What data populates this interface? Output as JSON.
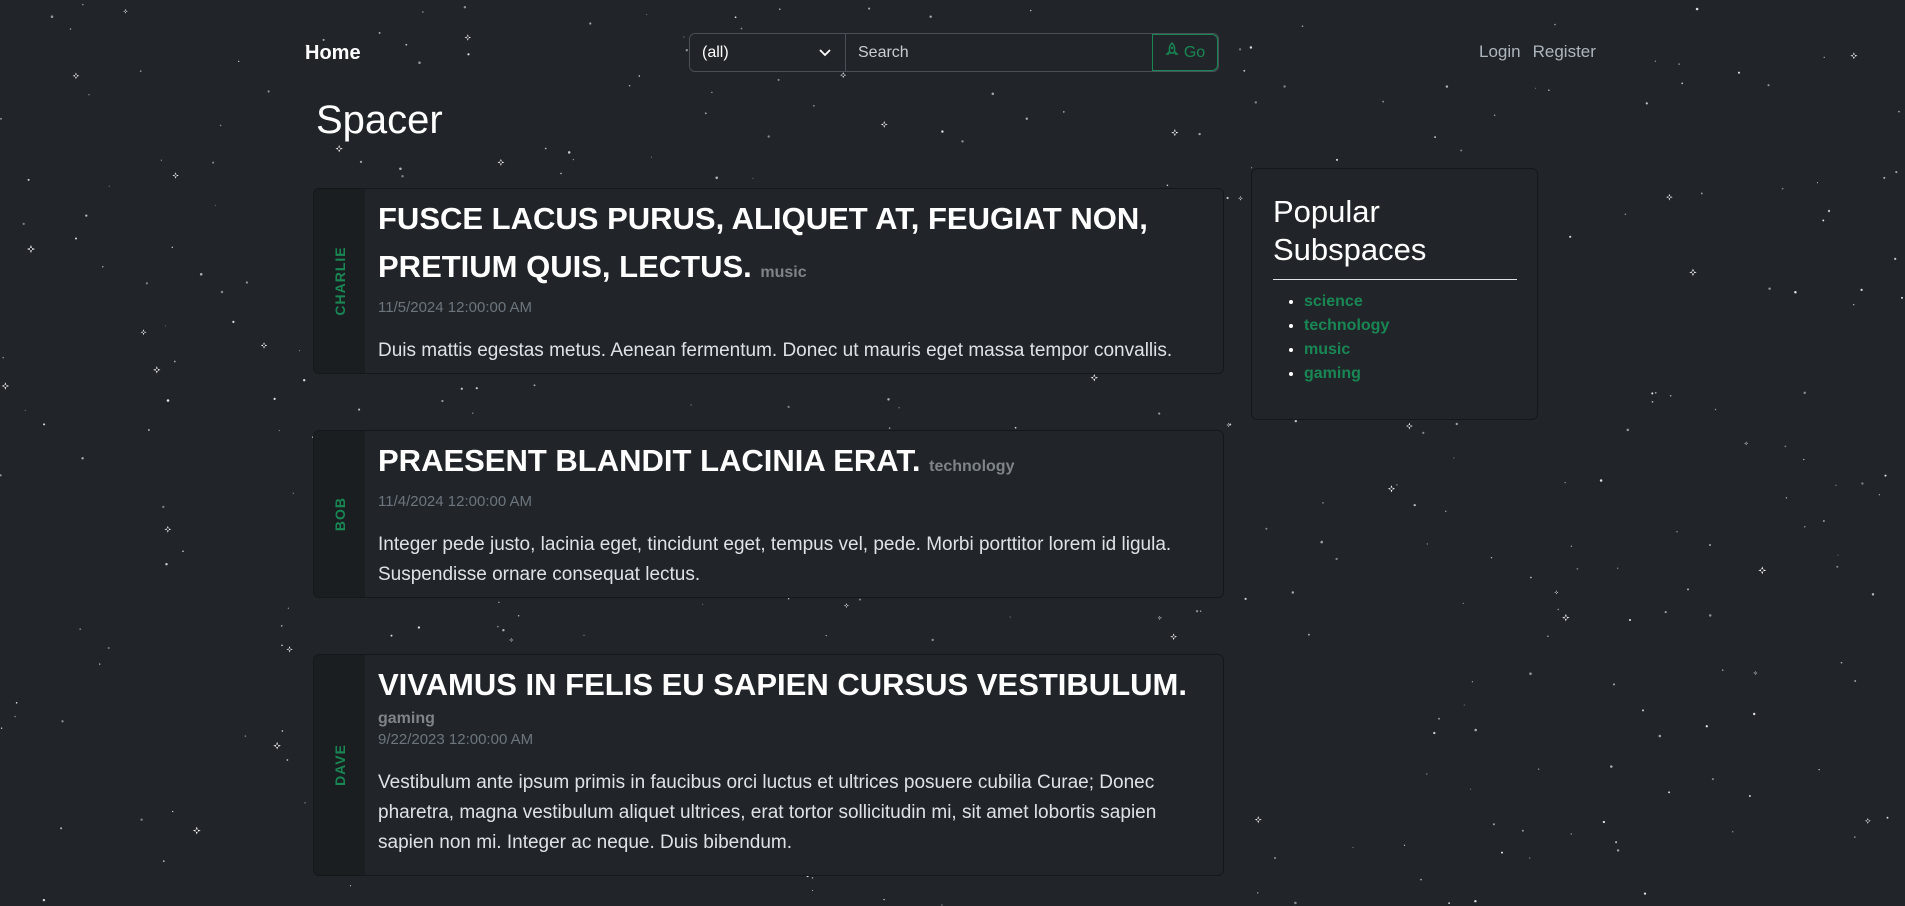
{
  "nav": {
    "brand": "Home",
    "search": {
      "selected": "(all)",
      "placeholder": "Search",
      "go_label": "Go"
    },
    "login": "Login",
    "register": "Register"
  },
  "page_title": "Spacer",
  "posts": [
    {
      "author": "CHARLIE",
      "title": "FUSCE LACUS PURUS, ALIQUET AT, FEUGIAT NON, PRETIUM QUIS, LECTUS.",
      "subspace": "music",
      "date": "11/5/2024 12:00:00 AM",
      "text": "Duis mattis egestas metus. Aenean fermentum. Donec ut mauris eget massa tempor convallis."
    },
    {
      "author": "BOB",
      "title": "PRAESENT BLANDIT LACINIA ERAT.",
      "subspace": "technology",
      "date": "11/4/2024 12:00:00 AM",
      "text": "Integer pede justo, lacinia eget, tincidunt eget, tempus vel, pede. Morbi porttitor lorem id ligula. Suspendisse ornare consequat lectus."
    },
    {
      "author": "DAVE",
      "title": "VIVAMUS IN FELIS EU SAPIEN CURSUS VESTIBULUM.",
      "subspace": "gaming",
      "date": "9/22/2023 12:00:00 AM",
      "text": "Vestibulum ante ipsum primis in faucibus orci luctus et ultrices posuere cubilia Curae; Donec pharetra, magna vestibulum aliquet ultrices, erat tortor sollicitudin mi, sit amet lobortis sapien sapien non mi. Integer ac neque. Duis bibendum."
    }
  ],
  "sidebar": {
    "title": "Popular Subspaces",
    "items": [
      "science",
      "technology",
      "music",
      "gaming"
    ]
  },
  "colors": {
    "background": "#212529",
    "accent": "#198754"
  },
  "icons": {
    "go": "rocket-icon",
    "select": "chevron-down-icon"
  }
}
